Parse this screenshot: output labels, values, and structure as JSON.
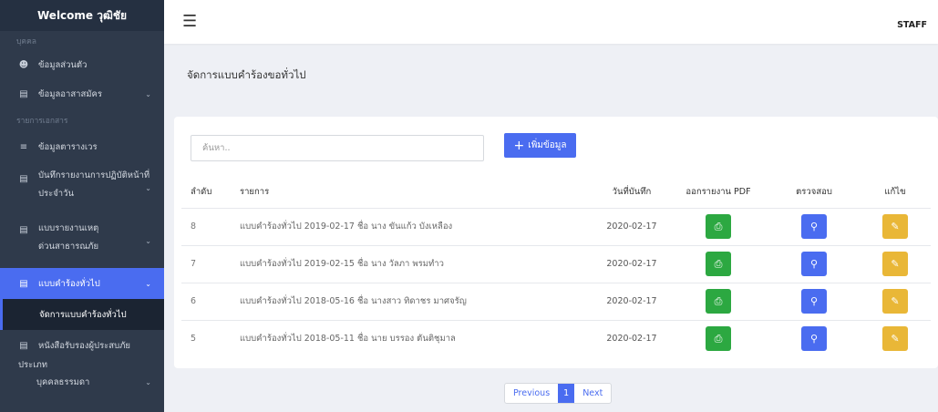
{
  "sidebar": {
    "welcome": "Welcome วุฒิชัย",
    "section_person": "บุคคล",
    "section_docs": "รายการเอกสาร",
    "items": [
      {
        "label": "ข้อมูลส่วนตัว",
        "icon": "user-icon"
      },
      {
        "label": "ข้อมูลอาสาสมัคร",
        "icon": "id-card-icon"
      },
      {
        "label": "ข้อมูลตารางเวร",
        "icon": "list-icon"
      },
      {
        "label_1": "บันทึกรายงานการปฏิบัติหน้าที่",
        "label_2": "ประจำวัน",
        "icon": "file-icon"
      },
      {
        "label_1": "แบบรายงานเหตุ",
        "label_2": "ด่วนสาธารณภัย",
        "icon": "file-icon"
      },
      {
        "label": "แบบคำร้องทั่วไป",
        "icon": "file-icon"
      },
      {
        "label_1": "หนังสือรับรองผู้ประสบภัย",
        "icon": "file-icon"
      }
    ],
    "submenu_active": "จัดการแบบคำร้องทั่วไป",
    "extra_1": "ประเภท",
    "extra_2": "บุคคลธรรมดา"
  },
  "topbar": {
    "menu_icon": "hamburger-icon",
    "user_role": "STAFF"
  },
  "page": {
    "title": "จัดการแบบคำร้องขอทั่วไป"
  },
  "toolbar": {
    "search_placeholder": "ค้นหา..",
    "add_label": "เพิ่มข้อมูล"
  },
  "table": {
    "headers": {
      "no": "ลำดับ",
      "item": "รายการ",
      "date": "วันที่บันทึก",
      "pdf": "ออกรายงาน PDF",
      "check": "ตรวจสอบ",
      "edit": "แก้ไข"
    },
    "rows": [
      {
        "no": "8",
        "item": "แบบคำร้องทั่วไป 2019-02-17 ชื่อ นาง ขันแก้ว บังเหลือง",
        "date": "2020-02-17"
      },
      {
        "no": "7",
        "item": "แบบคำร้องทั่วไป 2019-02-15 ชื่อ นาง วัลภา พรมทำว",
        "date": "2020-02-17"
      },
      {
        "no": "6",
        "item": "แบบคำร้องทั่วไป 2018-05-16 ชื่อ นางสาว ทิดาชร มาศจรัญ",
        "date": "2020-02-17"
      },
      {
        "no": "5",
        "item": "แบบคำร้องทั่วไป 2018-05-11 ชื่อ นาย บรรอง ตันติชุมาล",
        "date": "2020-02-17"
      }
    ]
  },
  "pagination": {
    "previous": "Previous",
    "current": "1",
    "next": "Next"
  },
  "colors": {
    "sidebar_bg": "#2f3a4b",
    "accent": "#4a6cf0",
    "pdf_button": "#2ca841",
    "edit_button": "#e9b737"
  }
}
